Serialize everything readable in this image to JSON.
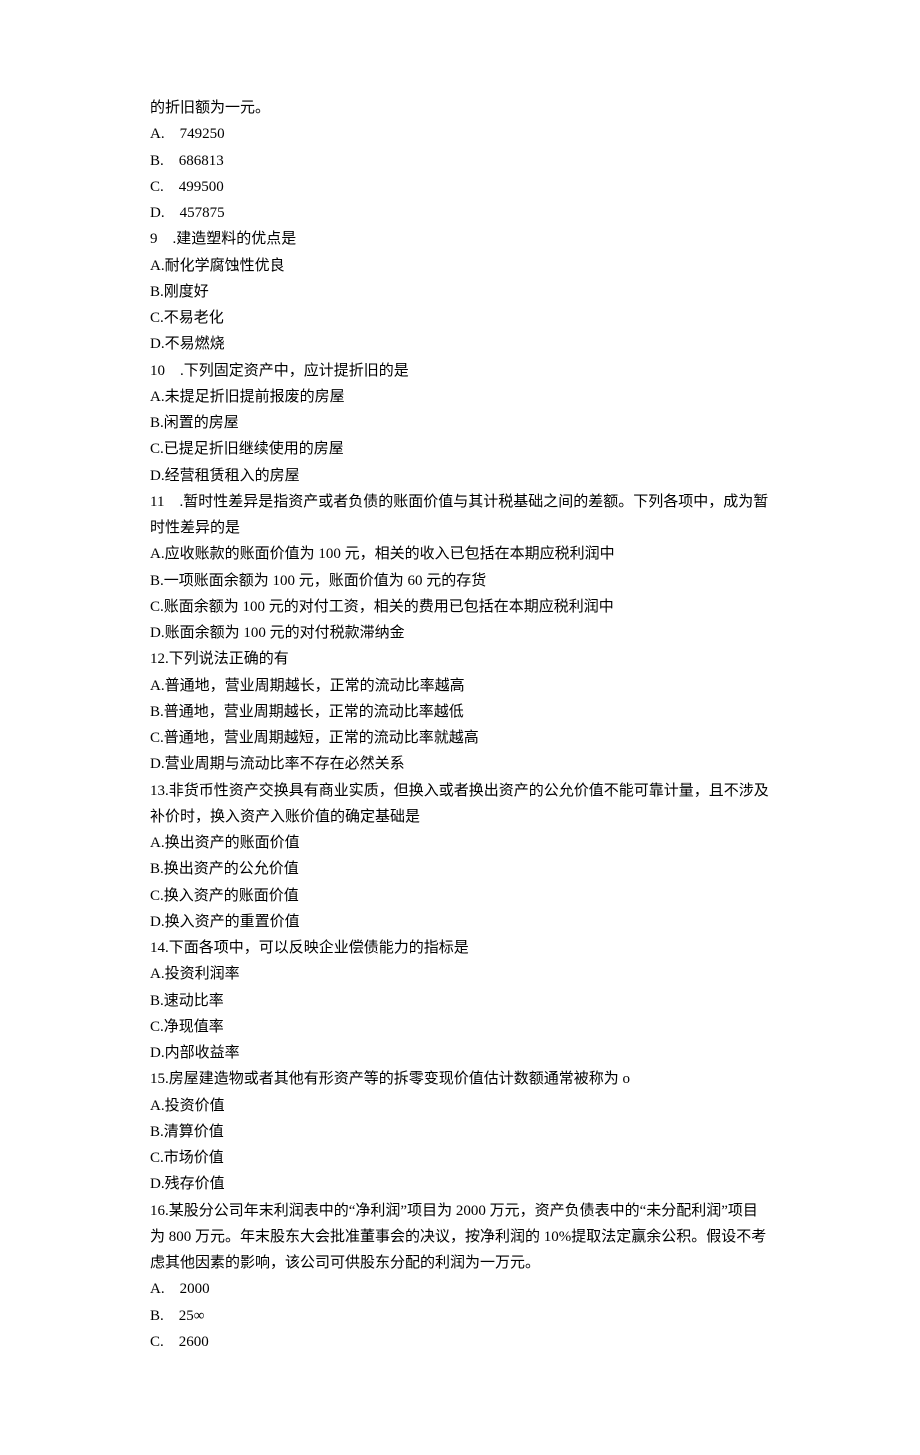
{
  "lines": [
    "的折旧额为一元。",
    "A.    749250",
    "B.    686813",
    "C.    499500",
    "D.    457875",
    "9    .建造塑料的优点是",
    "A.耐化学腐蚀性优良",
    "B.刚度好",
    "C.不易老化",
    "D.不易燃烧",
    "10    .下列固定资产中，应计提折旧的是",
    "A.未提足折旧提前报废的房屋",
    "B.闲置的房屋",
    "C.已提足折旧继续使用的房屋",
    "D.经营租赁租入的房屋",
    "11    .暂时性差异是指资产或者负债的账面价值与其计税基础之间的差额。下列各项中，成为暂时性差异的是",
    "A.应收账款的账面价值为 100 元，相关的收入已包括在本期应税利润中",
    "B.一项账面余额为 100 元，账面价值为 60 元的存货",
    "C.账面余额为 100 元的对付工资，相关的费用已包括在本期应税利润中",
    "D.账面余额为 100 元的对付税款滞纳金",
    "12.下列说法正确的有",
    "A.普通地，营业周期越长，正常的流动比率越高",
    "B.普通地，营业周期越长，正常的流动比率越低",
    "C.普通地，营业周期越短，正常的流动比率就越高",
    "D.营业周期与流动比率不存在必然关系",
    "13.非货币性资产交换具有商业实质，但换入或者换出资产的公允价值不能可靠计量，且不涉及补价时，换入资产入账价值的确定基础是",
    "A.换出资产的账面价值",
    "B.换出资产的公允价值",
    "C.换入资产的账面价值",
    "D.换入资产的重置价值",
    "14.下面各项中，可以反映企业偿债能力的指标是",
    "A.投资利润率",
    "B.速动比率",
    "C.净现值率",
    "D.内部收益率",
    "15.房屋建造物或者其他有形资产等的拆零变现价值估计数额通常被称为 o",
    "A.投资价值",
    "B.清算价值",
    "C.市场价值",
    "D.残存价值",
    "16.某股分公司年末利润表中的“净利润”项目为 2000 万元，资产负债表中的“未分配利润”项目为 800 万元。年末股东大会批准董事会的决议，按净利润的 10%提取法定赢余公积。假设不考虑其他因素的影响，该公司可供股东分配的利润为一万元。",
    "A.    2000",
    "B.    25∞",
    "C.    2600"
  ]
}
